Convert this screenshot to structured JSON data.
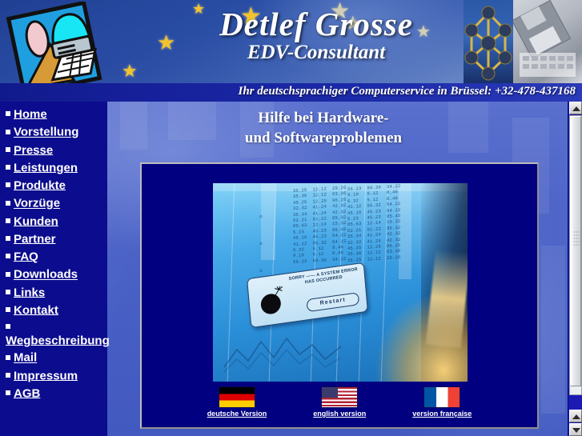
{
  "header": {
    "brand_name": "Detlef Grosse",
    "brand_subtitle": "EDV-Consultant",
    "tagline": "Ihr deutschsprachiger Computerservice in Brüssel: +32-478-437168",
    "logo_alt": "computer-logo",
    "photo_atomium_alt": "atomium-photo",
    "photo_keyboard_alt": "keyboard-floppy-photo"
  },
  "sidebar": {
    "items": [
      {
        "label": "Home"
      },
      {
        "label": "Vorstellung"
      },
      {
        "label": "Presse"
      },
      {
        "label": "Leistungen"
      },
      {
        "label": "Produkte"
      },
      {
        "label": "Vorzüge"
      },
      {
        "label": "Kunden"
      },
      {
        "label": "Partner"
      },
      {
        "label": "FAQ"
      },
      {
        "label": "Downloads"
      },
      {
        "label": "Links"
      },
      {
        "label": "Kontakt"
      },
      {
        "label": "Wegbeschreibung"
      },
      {
        "label": "Mail"
      },
      {
        "label": "Impressum"
      },
      {
        "label": "AGB"
      }
    ]
  },
  "main": {
    "heading_line1": "Hilfe bei Hardware-",
    "heading_line2": "und Softwareproblemen",
    "photo": {
      "alt": "blue-computer-screen-error-photo",
      "dialog_text": "SORRY —— A SYSTEM ERROR HAS OCCURRED",
      "dialog_button": "Restart",
      "spreadsheet_numbers": [
        "35.25  12.12  29.26",
        "35.36  12.12  63.36",
        "45.25  12.25  96.25",
        "32.32  41.24  42.32",
        "35.34  41.24  42.32",
        "52.21  51.22  85.32",
        "85.63  12.14  15.32",
        "5.23   45.23  85.45",
        "45.16  45.23  54.22",
        "41.12  55.32  54.22",
        "6.32   5.12   8.46",
        "9.10   5.12   8.46",
        "56.23  59.36  34.22"
      ]
    },
    "languages": [
      {
        "flag": "flag-de",
        "label": "deutsche Version"
      },
      {
        "flag": "flag-us",
        "label": "english version"
      },
      {
        "flag": "flag-fr",
        "label": "version française"
      }
    ]
  },
  "scrollbar": {
    "up_icon": "triangle-up-icon",
    "down_icon": "triangle-down-icon",
    "down_icon_2": "triangle-down-icon"
  },
  "colors": {
    "sidebar_bg": "#0c0c8e",
    "panel_bg": "#000080",
    "body_bg": "#4a61c6",
    "link": "#ffffff",
    "tagline_bar": "#16209a"
  }
}
